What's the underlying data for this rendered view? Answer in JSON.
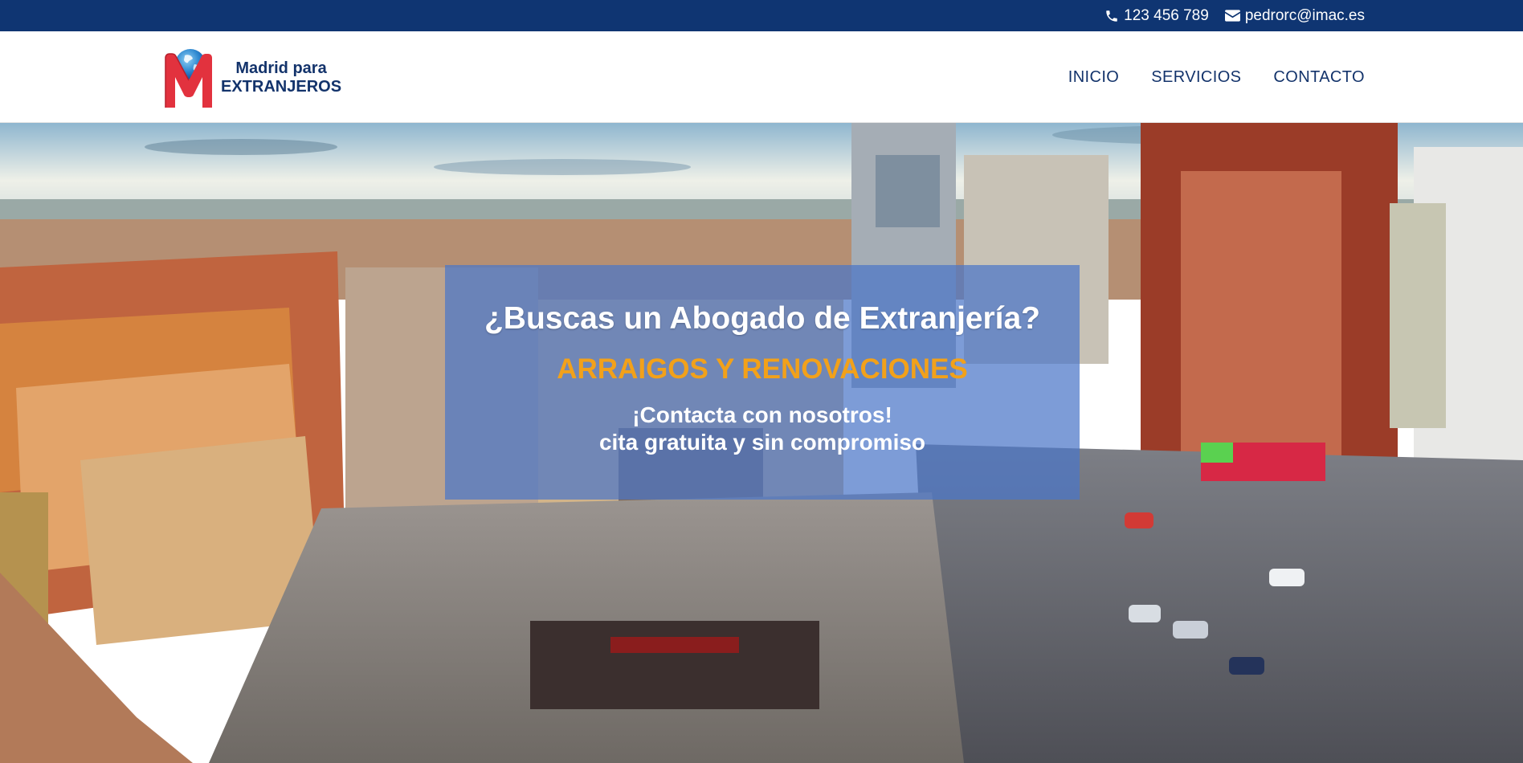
{
  "topbar": {
    "phone": "123 456 789",
    "email": "pedrorc@imac.es",
    "phone_icon": "phone-icon",
    "email_icon": "envelope-icon"
  },
  "header": {
    "logo": {
      "line1": "Madrid para",
      "line2": "EXTRANJEROS",
      "mark_letter": "M"
    },
    "nav": [
      {
        "label": "INICIO"
      },
      {
        "label": "SERVICIOS"
      },
      {
        "label": "CONTACTO"
      }
    ]
  },
  "hero": {
    "title": "¿Buscas un Abogado de Extranjería?",
    "subtitle": "ARRAIGOS Y RENOVACIONES",
    "cta_line1": "¡Contacta con nosotros!",
    "cta_line2": "cita gratuita y sin compromiso",
    "background": "aerial-city-photo"
  },
  "colors": {
    "brand_navy": "#0f3572",
    "nav_text": "#13336b",
    "accent_orange": "#f2a11a",
    "panel_blue": "#4b76c8",
    "logo_red": "#e2323e"
  }
}
